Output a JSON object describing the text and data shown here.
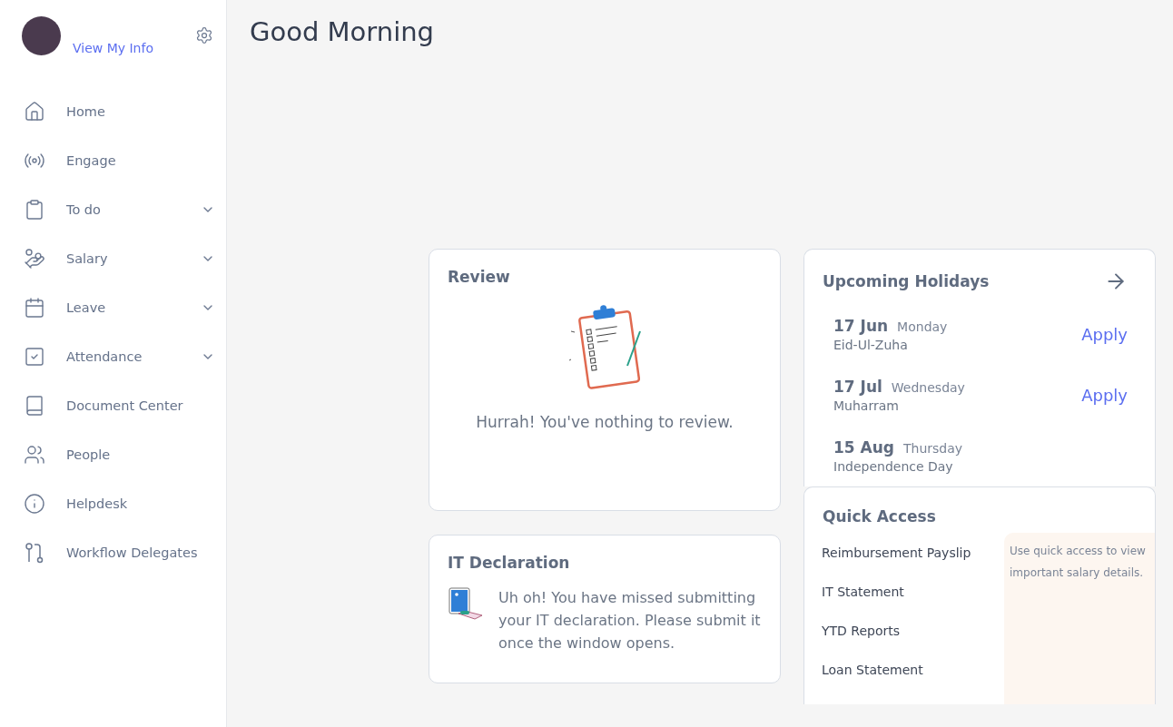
{
  "sidebar": {
    "profile": {
      "link": "View My Info"
    },
    "items": [
      {
        "label": "Home",
        "kind": "link"
      },
      {
        "label": "Engage",
        "kind": "link"
      },
      {
        "label": "To do",
        "kind": "group"
      },
      {
        "label": "Salary",
        "kind": "group"
      },
      {
        "label": "Leave",
        "kind": "group"
      },
      {
        "label": "Attendance",
        "kind": "group"
      },
      {
        "label": "Document Center",
        "kind": "link"
      },
      {
        "label": "People",
        "kind": "link"
      },
      {
        "label": "Helpdesk",
        "kind": "link"
      },
      {
        "label": "Workflow Delegates",
        "kind": "link"
      }
    ]
  },
  "greeting": "Good Morning",
  "review": {
    "title": "Review",
    "message": "Hurrah! You've nothing to review."
  },
  "it_declaration": {
    "title": "IT Declaration",
    "message": "Uh oh! You have missed submitting your IT declaration. Please submit it once the window opens."
  },
  "holidays": {
    "title": "Upcoming Holidays",
    "items": [
      {
        "date": "17 Jun",
        "day": "Monday",
        "name": "Eid-Ul-Zuha",
        "action": "Apply"
      },
      {
        "date": "17 Jul",
        "day": "Wednesday",
        "name": "Muharram",
        "action": "Apply"
      },
      {
        "date": "15 Aug",
        "day": "Thursday",
        "name": "Independence Day"
      }
    ]
  },
  "quick_access": {
    "title": "Quick Access",
    "links": [
      "Reimbursement Payslip",
      "IT Statement",
      "YTD Reports",
      "Loan Statement"
    ],
    "hint": "Use quick access to view important salary details."
  }
}
